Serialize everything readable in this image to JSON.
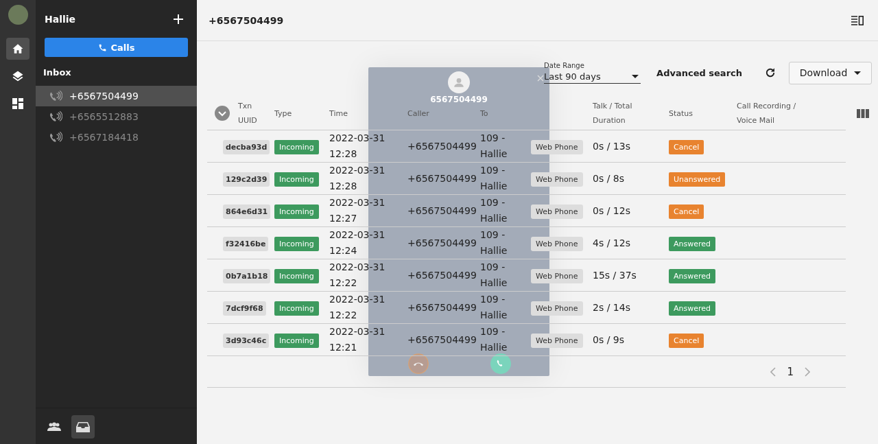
{
  "user": {
    "name": "Hallie"
  },
  "calls_button": "Calls",
  "inbox": {
    "title": "Inbox",
    "items": [
      {
        "number": "+6567504499",
        "selected": true
      },
      {
        "number": "+6565512883",
        "selected": false
      },
      {
        "number": "+6567184418",
        "selected": false
      }
    ]
  },
  "rail": [
    {
      "kind": "home",
      "selected": true
    },
    {
      "kind": "layers",
      "selected": false
    },
    {
      "kind": "dashboard",
      "selected": false
    }
  ],
  "bottom_tabs": [
    {
      "kind": "team",
      "selected": false
    },
    {
      "kind": "inbox",
      "selected": true
    }
  ],
  "header": {
    "title": "+6567504499"
  },
  "filters": {
    "date_range_label": "Date Range",
    "date_range_value": "Last 90 days",
    "advanced_search": "Advanced search",
    "download": "Download"
  },
  "table": {
    "columns": [
      "Txn UUID",
      "Type",
      "Time",
      "Caller",
      "To",
      "",
      "Talk / Total Duration",
      "Status",
      "Call Recording / Voice Mail"
    ],
    "rows": [
      {
        "uuid": "decba93d",
        "type": "Incoming",
        "time": "2022-03-31 12:28",
        "caller": "+6567504499",
        "to": "109 - Hallie",
        "via": "Web Phone",
        "duration": "0s / 13s",
        "status": {
          "label": "Cancel",
          "color": "#e8832f"
        }
      },
      {
        "uuid": "129c2d39",
        "type": "Incoming",
        "time": "2022-03-31 12:28",
        "caller": "+6567504499",
        "to": "109 - Hallie",
        "via": "Web Phone",
        "duration": "0s / 8s",
        "status": {
          "label": "Unanswered",
          "color": "#e8832f"
        }
      },
      {
        "uuid": "864e6d31",
        "type": "Incoming",
        "time": "2022-03-31 12:27",
        "caller": "+6567504499",
        "to": "109 - Hallie",
        "via": "Web Phone",
        "duration": "0s / 12s",
        "status": {
          "label": "Cancel",
          "color": "#e8832f"
        }
      },
      {
        "uuid": "f32416be",
        "type": "Incoming",
        "time": "2022-03-31 12:24",
        "caller": "+6567504499",
        "to": "109 - Hallie",
        "via": "Web Phone",
        "duration": "4s / 12s",
        "status": {
          "label": "Answered",
          "color": "#3d9a5e"
        }
      },
      {
        "uuid": "0b7a1b18",
        "type": "Incoming",
        "time": "2022-03-31 12:22",
        "caller": "+6567504499",
        "to": "109 - Hallie",
        "via": "Web Phone",
        "duration": "15s / 37s",
        "status": {
          "label": "Answered",
          "color": "#3d9a5e"
        }
      },
      {
        "uuid": "7dcf9f68",
        "type": "Incoming",
        "time": "2022-03-31 12:22",
        "caller": "+6567504499",
        "to": "109 - Hallie",
        "via": "Web Phone",
        "duration": "2s / 14s",
        "status": {
          "label": "Answered",
          "color": "#3d9a5e"
        }
      },
      {
        "uuid": "3d93c46c",
        "type": "Incoming",
        "time": "2022-03-31 12:21",
        "caller": "+6567504499",
        "to": "109 - Hallie",
        "via": "Web Phone",
        "duration": "0s / 9s",
        "status": {
          "label": "Cancel",
          "color": "#e8832f"
        }
      }
    ]
  },
  "pagination": {
    "page": "1"
  },
  "call_dialog": {
    "number": "6567504499"
  }
}
